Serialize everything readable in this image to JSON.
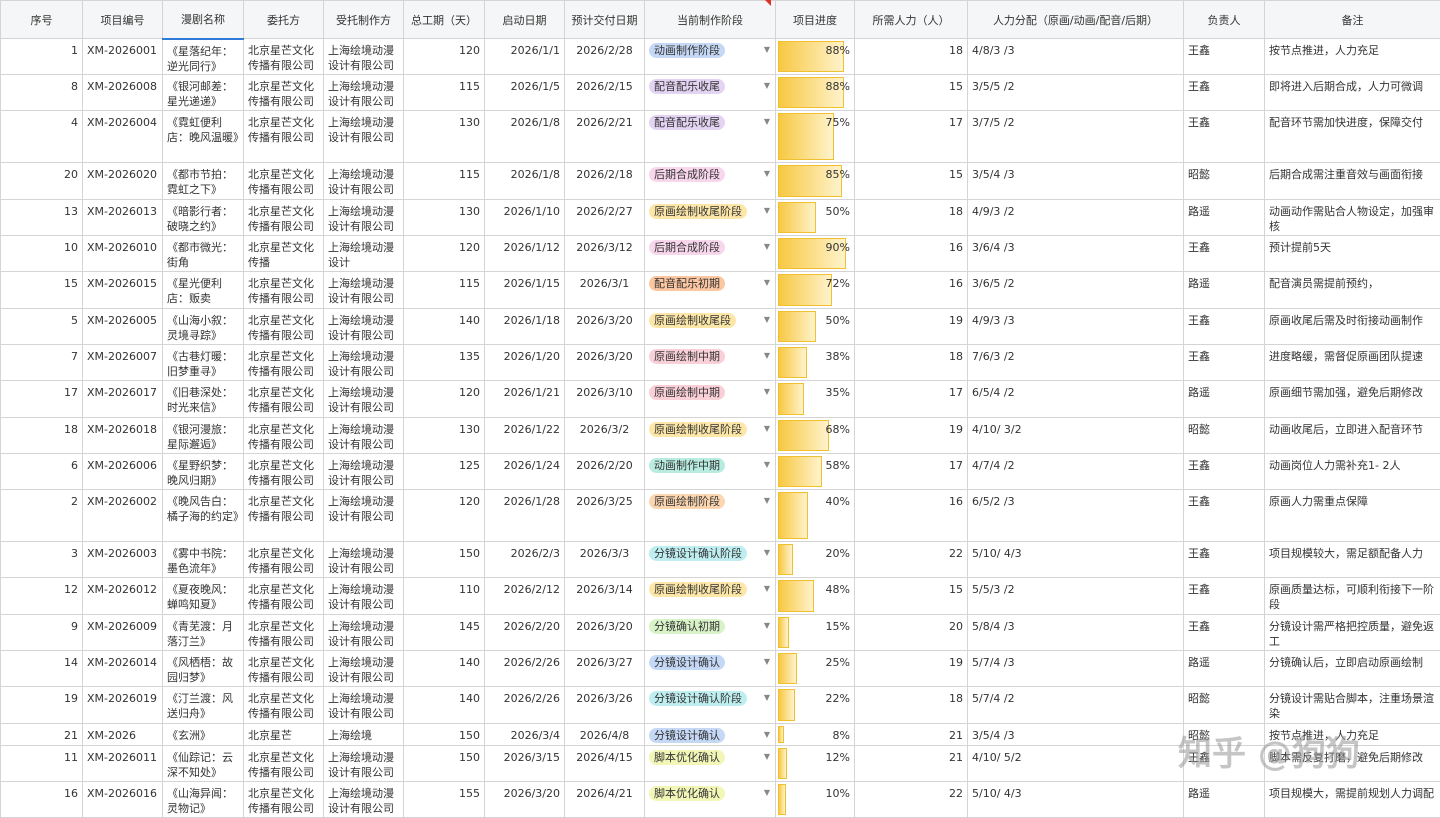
{
  "headers": [
    "序号",
    "项目编号",
    "漫剧名称",
    "委托方",
    "受托制作方",
    "总工期（天）",
    "启动日期",
    "预计交付日期",
    "当前制作阶段",
    "项目进度",
    "所需人力（人）",
    "人力分配（原画/动画/配音/后期）",
    "负责人",
    "备注"
  ],
  "stage_colors": {
    "动画制作阶段": "#c5d8f5",
    "配音配乐收尾": "#e2d4f2",
    "后期合成阶段": "#f8d7ec",
    "原画绘制收尾阶段": "#fde7a8",
    "配音配乐初期": "#fcc6a0",
    "原画绘制收尾段": "#fde7a8",
    "原画绘制中期": "#f9d0d8",
    "动画制作中期": "#b9ece0",
    "原画绘制阶段": "#fcd6b0",
    "分镜设计确认阶段": "#bfeef0",
    "分镜确认初期": "#d9f3c8",
    "分镜设计确认": "#c5d8f5",
    "脚本优化确认": "#f2f7b8"
  },
  "rows": [
    {
      "no": "1",
      "code": "XM-2026001",
      "name": "《星落纪年：逆光同行》",
      "client": "北京星芒文化传播有限公司",
      "vendor": "上海绘境动漫设计有限公司",
      "days": "120",
      "start": "2026/1/1",
      "due": "2026/2/28",
      "stage": "动画制作阶段",
      "progress": 0.88,
      "progress_label": "88%",
      "people": "18",
      "alloc": "4/8/3 /3",
      "owner": "王鑫",
      "note": "按节点推进，人力充足"
    },
    {
      "no": "8",
      "code": "XM-2026008",
      "name": "《银河邮差：星光递递》",
      "client": "北京星芒文化传播有限公司",
      "vendor": "上海绘境动漫设计有限公司",
      "days": "115",
      "start": "2026/1/5",
      "due": "2026/2/15",
      "stage": "配音配乐收尾",
      "progress": 0.88,
      "progress_label": "88%",
      "people": "15",
      "alloc": "3/5/5 /2",
      "owner": "王鑫",
      "note": "即将进入后期合成，人力可微调"
    },
    {
      "no": "4",
      "code": "XM-2026004",
      "name": "《霓虹便利店：晚风温暖》",
      "client": "北京星芒文化传播有限公司",
      "vendor": "上海绘境动漫设计有限公司",
      "days": "130",
      "start": "2026/1/8",
      "due": "2026/2/21",
      "stage": "配音配乐收尾",
      "progress": 0.75,
      "progress_label": "75%",
      "people": "17",
      "alloc": "3/7/5 /2",
      "owner": "王鑫",
      "note": "配音环节需加快进度，保障交付"
    },
    {
      "no": "20",
      "code": "XM-2026020",
      "name": "《都市节拍：霓虹之下》",
      "client": "北京星芒文化传播有限公司",
      "vendor": "上海绘境动漫设计有限公司",
      "days": "115",
      "start": "2026/1/8",
      "due": "2026/2/18",
      "stage": "后期合成阶段",
      "progress": 0.85,
      "progress_label": "85%",
      "people": "15",
      "alloc": "3/5/4 /3",
      "owner": "昭懿",
      "note": "后期合成需注重音效与画面衔接"
    },
    {
      "no": "13",
      "code": "XM-2026013",
      "name": "《暗影行者：破晓之约》",
      "client": "北京星芒文化传播有限公司",
      "vendor": "上海绘境动漫设计有限公司",
      "days": "130",
      "start": "2026/1/10",
      "due": "2026/2/27",
      "stage": "原画绘制收尾阶段",
      "progress": 0.5,
      "progress_label": "50%",
      "people": "18",
      "alloc": "4/9/3 /2",
      "owner": "路遥",
      "note": "动画动作需贴合人物设定，加强审核"
    },
    {
      "no": "10",
      "code": "XM-2026010",
      "name": "《都市微光：街角",
      "client": "北京星芒文化传播",
      "vendor": "上海绘境动漫设计",
      "days": "120",
      "start": "2026/1/12",
      "due": "2026/3/12",
      "stage": "后期合成阶段",
      "progress": 0.9,
      "progress_label": "90%",
      "people": "16",
      "alloc": "3/6/4 /3",
      "owner": "王鑫",
      "note": "预计提前5天"
    },
    {
      "no": "15",
      "code": "XM-2026015",
      "name": "《星光便利店：贩卖",
      "client": "北京星芒文化传播有限公司",
      "vendor": "上海绘境动漫设计有限公司",
      "days": "115",
      "start": "2026/1/15",
      "due": "2026/3/1",
      "stage": "配音配乐初期",
      "progress": 0.72,
      "progress_label": "72%",
      "people": "16",
      "alloc": "3/6/5 /2",
      "owner": "路遥",
      "note": "配音演员需提前预约，"
    },
    {
      "no": "5",
      "code": "XM-2026005",
      "name": "《山海小叙：灵境寻踪》",
      "client": "北京星芒文化传播有限公司",
      "vendor": "上海绘境动漫设计有限公司",
      "days": "140",
      "start": "2026/1/18",
      "due": "2026/3/20",
      "stage": "原画绘制收尾段",
      "progress": 0.5,
      "progress_label": "50%",
      "people": "19",
      "alloc": "4/9/3 /3",
      "owner": "王鑫",
      "note": "原画收尾后需及时衔接动画制作"
    },
    {
      "no": "7",
      "code": "XM-2026007",
      "name": "《古巷灯暖：旧梦重寻》",
      "client": "北京星芒文化传播有限公司",
      "vendor": "上海绘境动漫设计有限公司",
      "days": "135",
      "start": "2026/1/20",
      "due": "2026/3/20",
      "stage": "原画绘制中期",
      "progress": 0.38,
      "progress_label": "38%",
      "people": "18",
      "alloc": "7/6/3 /2",
      "owner": "王鑫",
      "note": "进度略缓，需督促原画团队提速"
    },
    {
      "no": "17",
      "code": "XM-2026017",
      "name": "《旧巷深处：时光来信》",
      "client": "北京星芒文化传播有限公司",
      "vendor": "上海绘境动漫设计有限公司",
      "days": "120",
      "start": "2026/1/21",
      "due": "2026/3/10",
      "stage": "原画绘制中期",
      "progress": 0.35,
      "progress_label": "35%",
      "people": "17",
      "alloc": "6/5/4 /2",
      "owner": "路遥",
      "note": "原画细节需加强，避免后期修改"
    },
    {
      "no": "18",
      "code": "XM-2026018",
      "name": "《银河漫旅：星际邂逅》",
      "client": "北京星芒文化传播有限公司",
      "vendor": "上海绘境动漫设计有限公司",
      "days": "130",
      "start": "2026/1/22",
      "due": "2026/3/2",
      "stage": "原画绘制收尾阶段",
      "progress": 0.68,
      "progress_label": "68%",
      "people": "19",
      "alloc": "4/10/ 3/2",
      "owner": "昭懿",
      "note": "动画收尾后，立即进入配音环节"
    },
    {
      "no": "6",
      "code": "XM-2026006",
      "name": "《星野织梦：晚风归期》",
      "client": "北京星芒文化传播有限公司",
      "vendor": "上海绘境动漫设计有限公司",
      "days": "125",
      "start": "2026/1/24",
      "due": "2026/2/20",
      "stage": "动画制作中期",
      "progress": 0.58,
      "progress_label": "58%",
      "people": "17",
      "alloc": "4/7/4 /2",
      "owner": "王鑫",
      "note": "动画岗位人力需补充1- 2人"
    },
    {
      "no": "2",
      "code": "XM-2026002",
      "name": "《晚风告白：橘子海的约定》",
      "client": "北京星芒文化传播有限公司",
      "vendor": "上海绘境动漫设计有限公司",
      "days": "120",
      "start": "2026/1/28",
      "due": "2026/3/25",
      "stage": "原画绘制阶段",
      "progress": 0.4,
      "progress_label": "40%",
      "people": "16",
      "alloc": "6/5/2 /3",
      "owner": "王鑫",
      "note": "原画人力需重点保障"
    },
    {
      "no": "3",
      "code": "XM-2026003",
      "name": "《雾中书院：墨色流年》",
      "client": "北京星芒文化传播有限公司",
      "vendor": "上海绘境动漫设计有限公司",
      "days": "150",
      "start": "2026/2/3",
      "due": "2026/3/3",
      "stage": "分镜设计确认阶段",
      "progress": 0.2,
      "progress_label": "20%",
      "people": "22",
      "alloc": "5/10/ 4/3",
      "owner": "王鑫",
      "note": "项目规模较大，需足额配备人力"
    },
    {
      "no": "12",
      "code": "XM-2026012",
      "name": "《夏夜晚风：蝉鸣知夏》",
      "client": "北京星芒文化传播有限公司",
      "vendor": "上海绘境动漫设计有限公司",
      "days": "110",
      "start": "2026/2/12",
      "due": "2026/3/14",
      "stage": "原画绘制收尾阶段",
      "progress": 0.48,
      "progress_label": "48%",
      "people": "15",
      "alloc": "5/5/3 /2",
      "owner": "王鑫",
      "note": "原画质量达标，可顺利衔接下一阶段"
    },
    {
      "no": "9",
      "code": "XM-2026009",
      "name": "《青芜渡：月落汀兰》",
      "client": "北京星芒文化传播有限公司",
      "vendor": "上海绘境动漫设计有限公司",
      "days": "145",
      "start": "2026/2/20",
      "due": "2026/3/20",
      "stage": "分镜确认初期",
      "progress": 0.15,
      "progress_label": "15%",
      "people": "20",
      "alloc": "5/8/4 /3",
      "owner": "王鑫",
      "note": "分镜设计需严格把控质量，避免返工"
    },
    {
      "no": "14",
      "code": "XM-2026014",
      "name": "《风栖梧：故园归梦》",
      "client": "北京星芒文化传播有限公司",
      "vendor": "上海绘境动漫设计有限公司",
      "days": "140",
      "start": "2026/2/26",
      "due": "2026/3/27",
      "stage": "分镜设计确认",
      "progress": 0.25,
      "progress_label": "25%",
      "people": "19",
      "alloc": "5/7/4 /3",
      "owner": "路遥",
      "note": "分镜确认后，立即启动原画绘制"
    },
    {
      "no": "19",
      "code": "XM-2026019",
      "name": "《汀兰渡：风送归舟》",
      "client": "北京星芒文化传播有限公司",
      "vendor": "上海绘境动漫设计有限公司",
      "days": "140",
      "start": "2026/2/26",
      "due": "2026/3/26",
      "stage": "分镜设计确认阶段",
      "progress": 0.22,
      "progress_label": "22%",
      "people": "18",
      "alloc": "5/7/4 /2",
      "owner": "昭懿",
      "note": "分镜设计需贴合脚本，注重场景渲染"
    },
    {
      "no": "21",
      "code": "XM-2026",
      "name": "《玄洲》",
      "client": "北京星芒",
      "vendor": "上海绘境",
      "days": "150",
      "start": "2026/3/4",
      "due": "2026/4/8",
      "stage": "分镜设计确认",
      "progress": 0.08,
      "progress_label": "8%",
      "people": "21",
      "alloc": "3/5/4 /3",
      "owner": "昭懿",
      "note": "按节点推进，人力充足"
    },
    {
      "no": "11",
      "code": "XM-2026011",
      "name": "《仙踪记：云深不知处》",
      "client": "北京星芒文化传播有限公司",
      "vendor": "上海绘境动漫设计有限公司",
      "days": "150",
      "start": "2026/3/15",
      "due": "2026/4/15",
      "stage": "脚本优化确认",
      "progress": 0.12,
      "progress_label": "12%",
      "people": "21",
      "alloc": "4/10/ 5/2",
      "owner": "王鑫",
      "note": "脚本需反复打磨，避免后期修改"
    },
    {
      "no": "16",
      "code": "XM-2026016",
      "name": "《山海异闻：灵物记》",
      "client": "北京星芒文化传播有限公司",
      "vendor": "上海绘境动漫设计有限公司",
      "days": "155",
      "start": "2026/3/20",
      "due": "2026/4/21",
      "stage": "脚本优化确认",
      "progress": 0.1,
      "progress_label": "10%",
      "people": "22",
      "alloc": "5/10/ 4/3",
      "owner": "路遥",
      "note": "项目规模大，需提前规划人力调配"
    }
  ],
  "watermark": "知乎 @狗狗"
}
